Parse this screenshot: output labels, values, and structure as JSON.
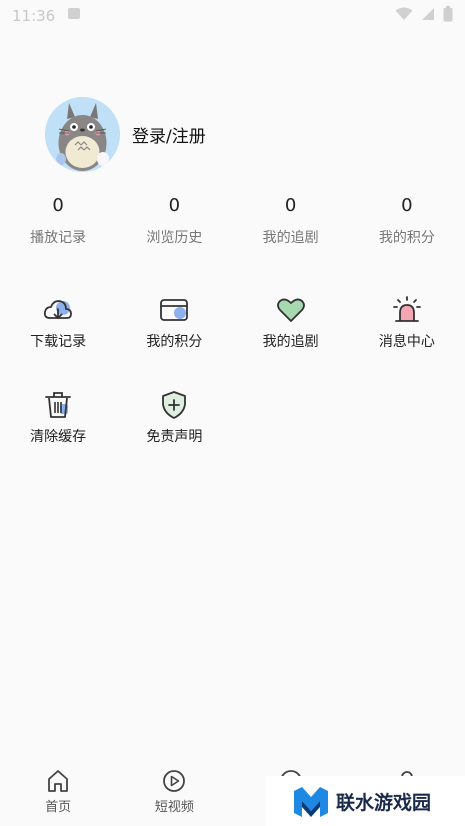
{
  "status_bar": {
    "time": "11:36"
  },
  "profile": {
    "login_label": "登录/注册"
  },
  "stats": [
    {
      "value": "0",
      "label": "播放记录"
    },
    {
      "value": "0",
      "label": "浏览历史"
    },
    {
      "value": "0",
      "label": "我的追剧"
    },
    {
      "value": "0",
      "label": "我的积分"
    }
  ],
  "menu_row1": [
    {
      "label": "下载记录",
      "icon": "cloud-download-icon"
    },
    {
      "label": "我的积分",
      "icon": "card-icon"
    },
    {
      "label": "我的追剧",
      "icon": "heart-icon"
    },
    {
      "label": "消息中心",
      "icon": "alarm-icon"
    }
  ],
  "menu_row2": [
    {
      "label": "清除缓存",
      "icon": "trash-icon"
    },
    {
      "label": "免责声明",
      "icon": "shield-plus-icon"
    }
  ],
  "bottom_nav": [
    {
      "label": "首页",
      "icon": "home-icon"
    },
    {
      "label": "短视频",
      "icon": "play-circle-icon"
    }
  ],
  "watermark": {
    "text": "联水游戏园"
  },
  "colors": {
    "background": "#fafafa",
    "icon_stroke": "#333333",
    "accent_blue": "#8fb0ee",
    "accent_green": "#a8d8b0",
    "accent_pink": "#f4a6b4"
  }
}
